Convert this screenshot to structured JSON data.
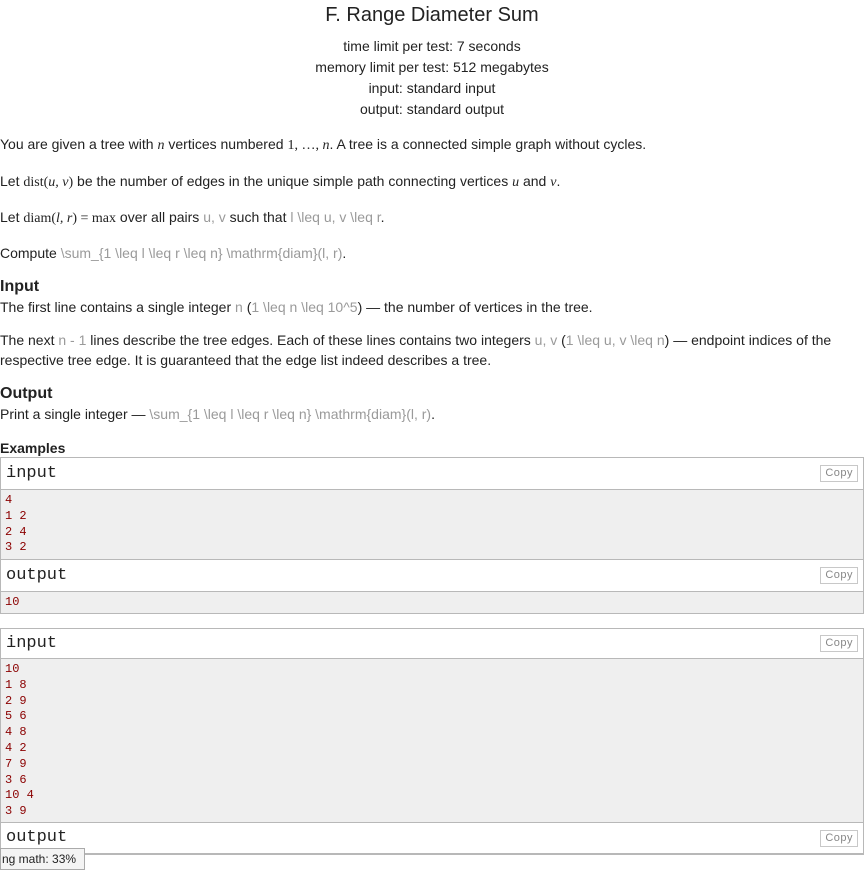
{
  "problem": {
    "title": "F. Range Diameter Sum",
    "time_limit": "time limit per test: 7 seconds",
    "memory_limit": "memory limit per test: 512 megabytes",
    "input": "input: standard input",
    "output": "output: standard output"
  },
  "legend": {
    "p1_a": "You are given a tree with ",
    "p1_n": "n",
    "p1_b": " vertices numbered ",
    "p1_range": "1, …, ",
    "p1_n2": "n",
    "p1_c": ". A tree is a connected simple graph without cycles.",
    "p2_a": "Let ",
    "p2_dist": "dist(",
    "p2_uv": "u, v",
    "p2_close": ")",
    "p2_b": " be the number of edges in the unique simple path connecting vertices ",
    "p2_u": "u",
    "p2_and": " and ",
    "p2_v": "v",
    "p2_end": ".",
    "p3_a": "Let ",
    "p3_diam": "diam(",
    "p3_lr": "l, r",
    "p3_eq": ") = max",
    "p3_b": "  over all pairs ",
    "p3_pairs": "u, v",
    "p3_c": " such that ",
    "p3_cond": "l \\leq u, v \\leq r",
    "p3_end": ".",
    "p4_a": "Compute ",
    "p4_sum": "\\sum_{1 \\leq l \\leq r \\leq n} \\mathrm{diam}(l, r)",
    "p4_end": "."
  },
  "input_section": {
    "title": "Input",
    "p1_a": "The first line contains a single integer ",
    "p1_n": "n",
    "p1_b": " (",
    "p1_cond": "1 \\leq n \\leq 10^5",
    "p1_c": ") — the number of vertices in the tree.",
    "p2_a": "The next ",
    "p2_n1": "n - 1",
    "p2_b": " lines describe the tree edges. Each of these lines contains two integers ",
    "p2_uv": "u, v",
    "p2_c": " (",
    "p2_cond": "1 \\leq u, v \\leq n",
    "p2_d": ") — endpoint indices of the respective tree edge. It is guaranteed that the edge list indeed describes a tree."
  },
  "output_section": {
    "title": "Output",
    "p1_a": "Print a single integer — ",
    "p1_sum": "\\sum_{1 \\leq l \\leq r \\leq n} \\mathrm{diam}(l, r)",
    "p1_end": "."
  },
  "examples": {
    "title": "Examples",
    "copy_label": "Copy",
    "input_label": "input",
    "output_label": "output",
    "sample1_input": "4\n1 2\n2 4\n3 2",
    "sample1_output": "10",
    "sample2_input": "10\n1 8\n2 9\n5 6\n4 8\n4 2\n7 9\n3 6\n10 4\n3 9"
  },
  "status": {
    "text": "ng math: 33%"
  }
}
